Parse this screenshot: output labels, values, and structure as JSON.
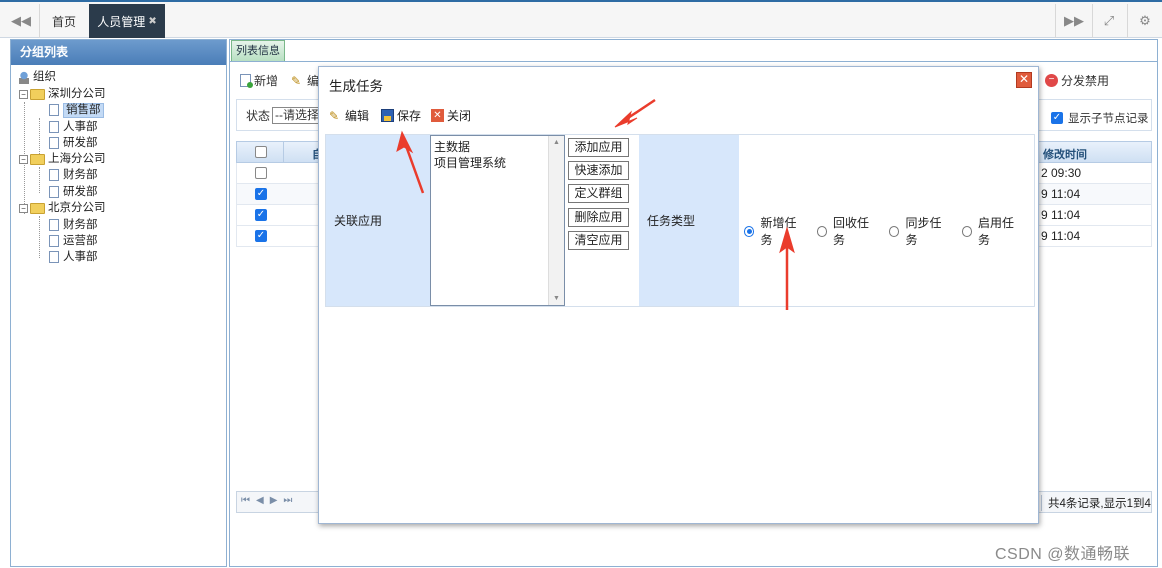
{
  "topbar": {
    "tabs": [
      {
        "label": "首页"
      },
      {
        "label": "人员管理",
        "close": "✖"
      }
    ],
    "icons": [
      "double-left-icon",
      "double-right-icon",
      "fullscreen-icon",
      "gear-icon"
    ]
  },
  "left_panel": {
    "title": "分组列表",
    "tree": {
      "root": "组织",
      "groups": [
        {
          "name": "深圳分公司",
          "children": [
            "销售部",
            "人事部",
            "研发部"
          ]
        },
        {
          "name": "上海分公司",
          "children": [
            "财务部",
            "研发部"
          ]
        },
        {
          "name": "北京分公司",
          "children": [
            "财务部",
            "运营部",
            "人事部"
          ]
        }
      ]
    }
  },
  "right_panel": {
    "tab": "列表信息",
    "toolbar": {
      "add": "新增",
      "edit_partial": "编",
      "disable": "分发禁用"
    },
    "filter": {
      "status_label": "状态",
      "status_value": "--请选择-",
      "show_children": "显示子节点记录"
    },
    "grid": {
      "header_partial": "自",
      "modified_header": "修改时间",
      "rows": [
        {
          "checked": false,
          "time": "2 09:30"
        },
        {
          "checked": true,
          "time": "9 11:04"
        },
        {
          "checked": true,
          "time": "9 11:04"
        },
        {
          "checked": true,
          "time": "9 11:04"
        }
      ]
    },
    "pager": {
      "summary": "共4条记录,显示1到4"
    }
  },
  "dialog": {
    "title": "生成任务",
    "toolbar": {
      "edit": "编辑",
      "save": "保存",
      "close": "关闭"
    },
    "form": {
      "related_apps_label": "关联应用",
      "apps": [
        "主数据",
        "项目管理系统"
      ],
      "buttons": [
        "添加应用",
        "快速添加",
        "定义群组",
        "删除应用",
        "清空应用"
      ],
      "task_type_label": "任务类型",
      "task_types": [
        "新增任务",
        "回收任务",
        "同步任务",
        "启用任务"
      ],
      "selected_task_type": "新增任务"
    }
  },
  "watermark": "CSDN @数通畅联",
  "colors": {
    "accent": "#2e6ca4",
    "label_bg": "#d7e7fb",
    "arrow": "#ea3c2c"
  }
}
